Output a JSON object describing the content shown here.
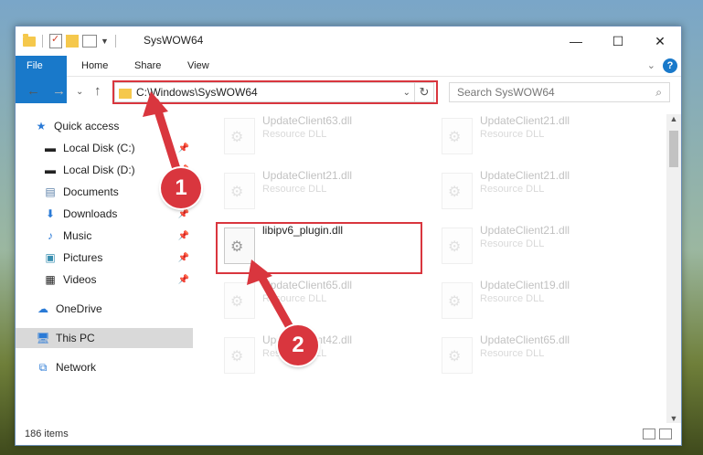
{
  "window": {
    "title": "SysWOW64",
    "controls": {
      "minimize": "—",
      "maximize": "☐",
      "close": "✕"
    }
  },
  "ribbon": {
    "tabs": [
      "File",
      "Home",
      "Share",
      "View"
    ],
    "help": "?"
  },
  "nav": {
    "address_path": "C:\\Windows\\SysWOW64",
    "search_placeholder": "Search SysWOW64"
  },
  "sidebar": {
    "items": [
      {
        "label": "Quick access",
        "icon": "star-icon",
        "pinned": false
      },
      {
        "label": "Local Disk (C:)",
        "icon": "drive-icon",
        "pinned": true
      },
      {
        "label": "Local Disk (D:)",
        "icon": "drive-icon",
        "pinned": true
      },
      {
        "label": "Documents",
        "icon": "documents-icon",
        "pinned": true
      },
      {
        "label": "Downloads",
        "icon": "download-icon",
        "pinned": true
      },
      {
        "label": "Music",
        "icon": "music-icon",
        "pinned": true
      },
      {
        "label": "Pictures",
        "icon": "pictures-icon",
        "pinned": true
      },
      {
        "label": "Videos",
        "icon": "videos-icon",
        "pinned": true
      },
      {
        "label": "OneDrive",
        "icon": "cloud-icon",
        "pinned": false
      },
      {
        "label": "This PC",
        "icon": "computer-icon",
        "pinned": false
      },
      {
        "label": "Network",
        "icon": "network-icon",
        "pinned": false
      }
    ]
  },
  "files": [
    {
      "name": "UpdateClient63.dll",
      "type": "Resource DLL"
    },
    {
      "name": "UpdateClient21.dll",
      "type": "Resource DLL"
    },
    {
      "name": "UpdateClient21.dll",
      "type": "Resource DLL"
    },
    {
      "name": "UpdateClient21.dll",
      "type": "Resource DLL"
    },
    {
      "name": "libipv6_plugin.dll",
      "type": ""
    },
    {
      "name": "UpdateClient21.dll",
      "type": "Resource DLL"
    },
    {
      "name": "UpdateClient65.dll",
      "type": "Resource DLL"
    },
    {
      "name": "UpdateClient19.dll",
      "type": "Resource DLL"
    },
    {
      "name": "UpdateClient42.dll",
      "type": "Resource DLL"
    },
    {
      "name": "UpdateClient65.dll",
      "type": "Resource DLL"
    }
  ],
  "status": {
    "item_count": "186 items"
  },
  "annotations": {
    "step1": "1",
    "step2": "2",
    "color": "#d9363e"
  }
}
